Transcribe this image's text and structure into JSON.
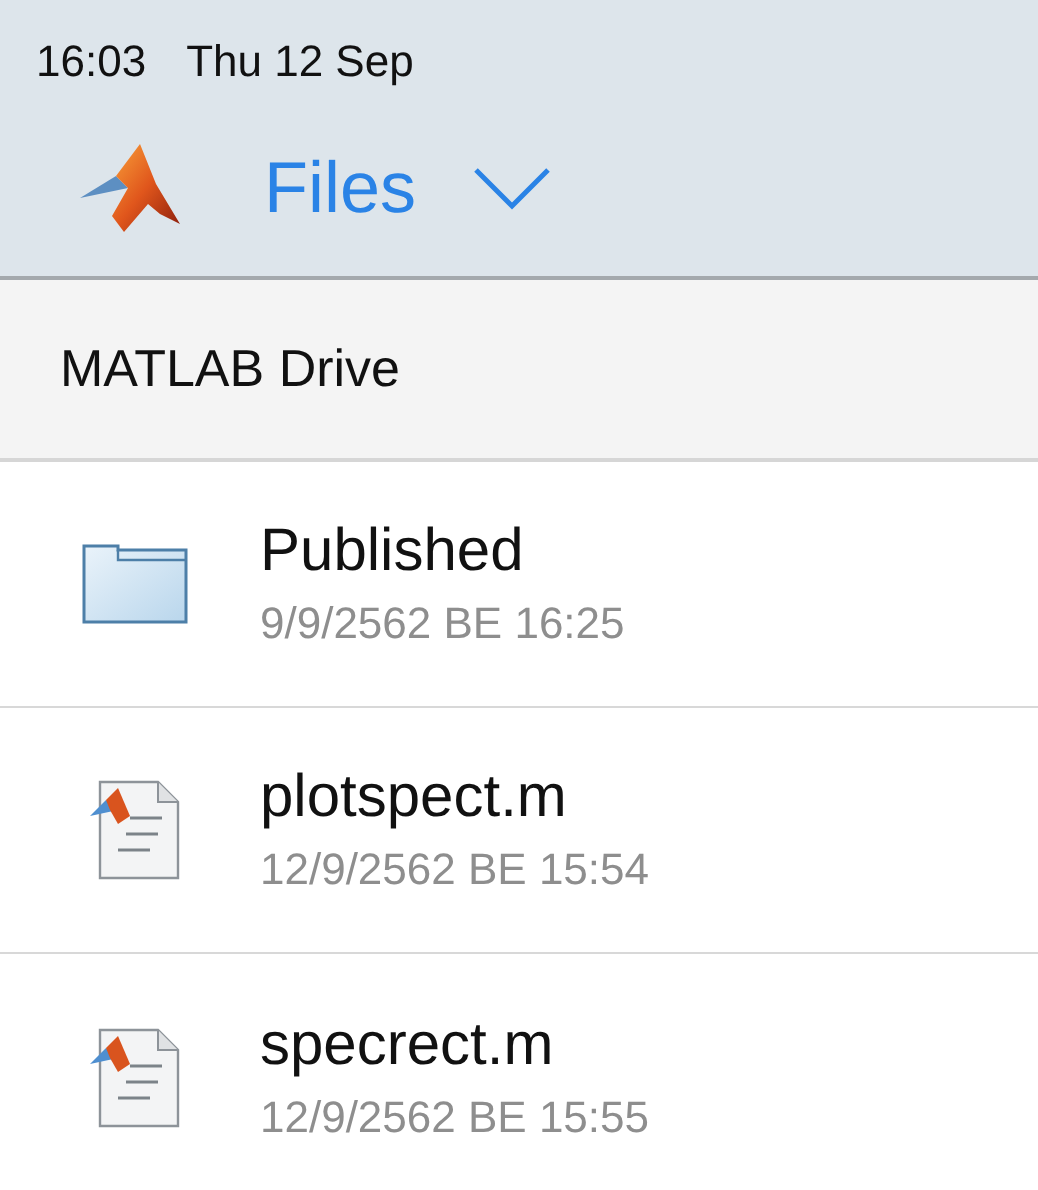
{
  "status_bar": {
    "time": "16:03",
    "date": "Thu 12 Sep"
  },
  "header": {
    "title": "Files"
  },
  "breadcrumb": "MATLAB Drive",
  "items": [
    {
      "kind": "folder",
      "name": "Published",
      "modified": "9/9/2562 BE 16:25"
    },
    {
      "kind": "file",
      "name": "plotspect.m",
      "modified": "12/9/2562 BE 15:54"
    },
    {
      "kind": "file",
      "name": "specrect.m",
      "modified": "12/9/2562 BE 15:55"
    }
  ]
}
